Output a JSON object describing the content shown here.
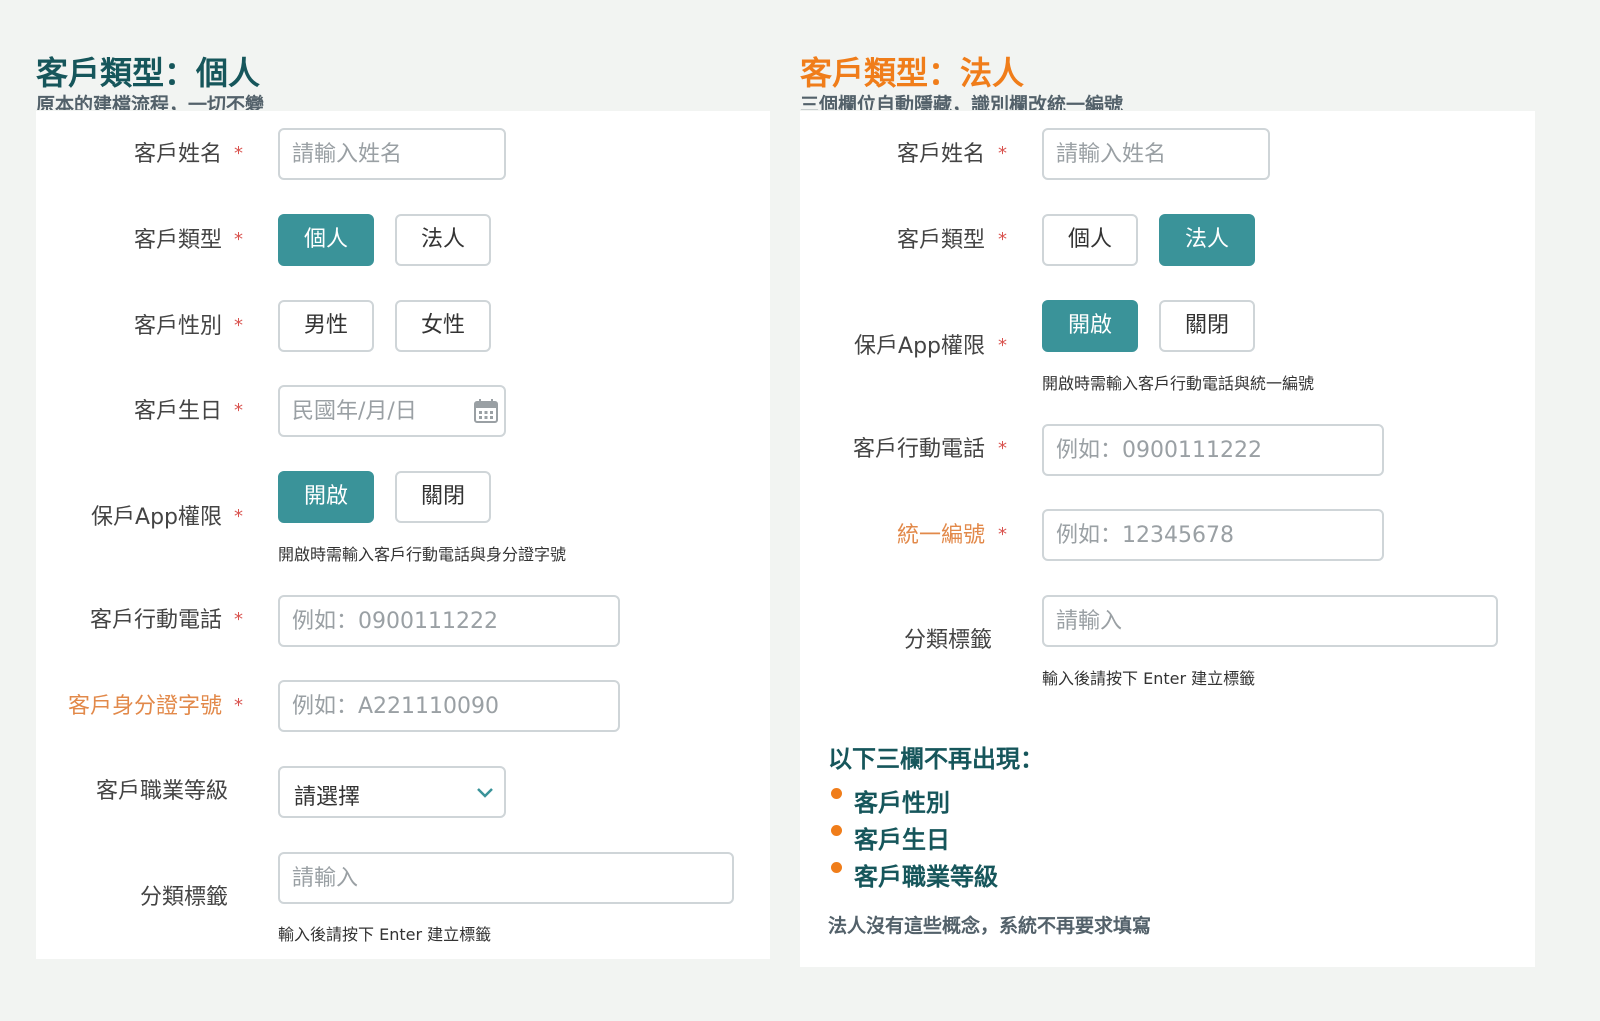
{
  "left": {
    "title": "客戶類型：個人",
    "subtitle": "原本的建檔流程，一切不變",
    "name": {
      "label": "客戶姓名",
      "placeholder": "請輸入姓名"
    },
    "type": {
      "label": "客戶類型",
      "options": [
        "個人",
        "法人"
      ],
      "selected": "個人"
    },
    "gender": {
      "label": "客戶性別",
      "options": [
        "男性",
        "女性"
      ]
    },
    "birthday": {
      "label": "客戶生日",
      "placeholder": "民國年/月/日",
      "icon": "calendar-icon"
    },
    "app": {
      "label": "保戶App權限",
      "options": [
        "開啟",
        "關閉"
      ],
      "selected": "開啟",
      "hint": "開啟時需輸入客戶行動電話與身分證字號"
    },
    "phone": {
      "label": "客戶行動電話",
      "placeholder": "例如：0900111222"
    },
    "id_number": {
      "label": "客戶身分證字號",
      "placeholder": "例如：A221110090"
    },
    "occupation": {
      "label": "客戶職業等級",
      "value": "請選擇",
      "icon": "chevron-down-icon"
    },
    "tags": {
      "label": "分類標籤",
      "placeholder": "請輸入",
      "hint": "輸入後請按下 Enter 建立標籤"
    },
    "required_mark": "*"
  },
  "right": {
    "title": "客戶類型：法人",
    "subtitle": "三個欄位自動隱藏，識別欄改統一編號",
    "name": {
      "label": "客戶姓名",
      "placeholder": "請輸入姓名"
    },
    "type": {
      "label": "客戶類型",
      "options": [
        "個人",
        "法人"
      ],
      "selected": "法人"
    },
    "app": {
      "label": "保戶App權限",
      "options": [
        "開啟",
        "關閉"
      ],
      "selected": "開啟",
      "hint": "開啟時需輸入客戶行動電話與統一編號"
    },
    "phone": {
      "label": "客戶行動電話",
      "placeholder": "例如：0900111222"
    },
    "tax_id": {
      "label": "統一編號",
      "placeholder": "例如：12345678"
    },
    "tags": {
      "label": "分類標籤",
      "placeholder": "請輸入",
      "hint": "輸入後請按下 Enter 建立標籤"
    },
    "removed_title": "以下三欄不再出現：",
    "removed_items": [
      "客戶性別",
      "客戶生日",
      "客戶職業等級"
    ],
    "removed_note": "法人沒有這些概念，系統不再要求填寫",
    "required_mark": "*"
  },
  "colors": {
    "teal": "#3a9399",
    "dark_teal": "#16565b",
    "orange": "#f07d1a",
    "accent_label": "#e2894a",
    "required": "#d9534f"
  }
}
